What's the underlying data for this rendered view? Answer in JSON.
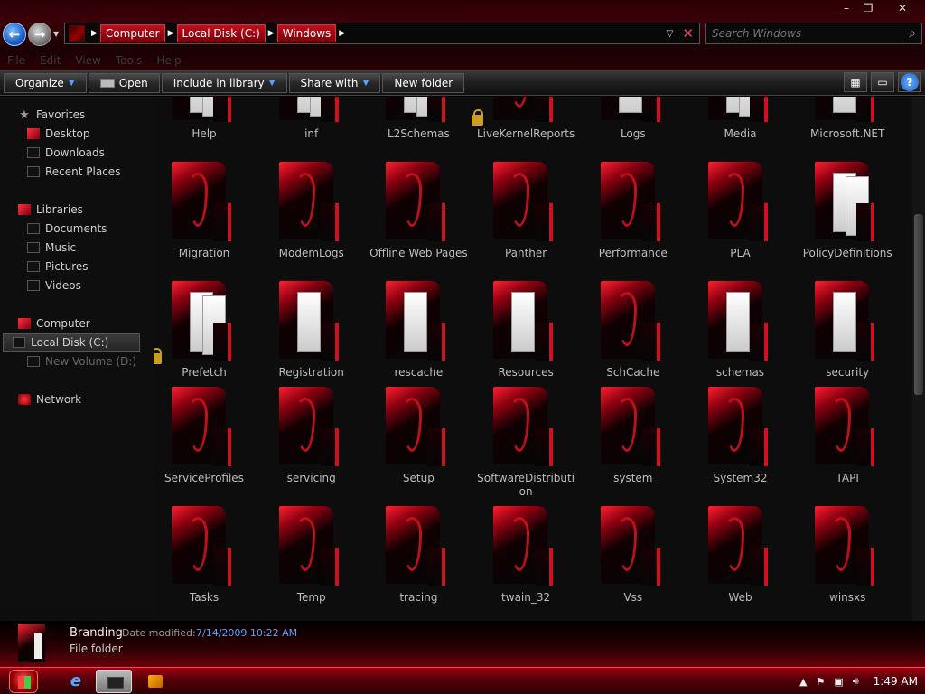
{
  "breadcrumb": [
    "Computer",
    "Local Disk (C:)",
    "Windows"
  ],
  "search": {
    "placeholder": "Search Windows"
  },
  "menu": [
    "File",
    "Edit",
    "View",
    "Tools",
    "Help"
  ],
  "toolbar": {
    "organize": "Organize",
    "open": "Open",
    "include": "Include in library",
    "share": "Share with",
    "newfolder": "New folder"
  },
  "nav": {
    "favorites": "Favorites",
    "desktop": "Desktop",
    "downloads": "Downloads",
    "recent": "Recent Places",
    "libraries": "Libraries",
    "documents": "Documents",
    "music": "Music",
    "pictures": "Pictures",
    "videos": "Videos",
    "computer": "Computer",
    "localdisk": "Local Disk (C:)",
    "newvolume": "New Volume (D:)",
    "network": "Network"
  },
  "folders": [
    {
      "name": "Help",
      "style": "paper2",
      "locked": false
    },
    {
      "name": "inf",
      "style": "paper2",
      "locked": false
    },
    {
      "name": "L2Schemas",
      "style": "paper2",
      "locked": false
    },
    {
      "name": "LiveKernelReports",
      "style": "dragon",
      "locked": true
    },
    {
      "name": "Logs",
      "style": "paper1",
      "locked": false
    },
    {
      "name": "Media",
      "style": "paper2",
      "locked": false
    },
    {
      "name": "Microsoft.NET",
      "style": "paper1",
      "locked": false
    },
    {
      "name": "Migration",
      "style": "dragon",
      "locked": false
    },
    {
      "name": "ModemLogs",
      "style": "dragon",
      "locked": false
    },
    {
      "name": "Offline Web Pages",
      "style": "dragon",
      "locked": false
    },
    {
      "name": "Panther",
      "style": "dragon",
      "locked": false
    },
    {
      "name": "Performance",
      "style": "dragon",
      "locked": false
    },
    {
      "name": "PLA",
      "style": "dragon",
      "locked": false
    },
    {
      "name": "PolicyDefinitions",
      "style": "paper2",
      "locked": false
    },
    {
      "name": "Prefetch",
      "style": "paper2",
      "locked": true
    },
    {
      "name": "Registration",
      "style": "paper1",
      "locked": false
    },
    {
      "name": "rescache",
      "style": "paper1",
      "locked": false
    },
    {
      "name": "Resources",
      "style": "paper1",
      "locked": false
    },
    {
      "name": "SchCache",
      "style": "dragon",
      "locked": false
    },
    {
      "name": "schemas",
      "style": "paper1",
      "locked": false
    },
    {
      "name": "security",
      "style": "paper1",
      "locked": false
    },
    {
      "name": "ServiceProfiles",
      "style": "dragon",
      "locked": false
    },
    {
      "name": "servicing",
      "style": "dragon",
      "locked": false
    },
    {
      "name": "Setup",
      "style": "dragon",
      "locked": false
    },
    {
      "name": "SoftwareDistribution",
      "style": "dragon",
      "locked": false
    },
    {
      "name": "system",
      "style": "dragon",
      "locked": false
    },
    {
      "name": "System32",
      "style": "dragon",
      "locked": false
    },
    {
      "name": "TAPI",
      "style": "dragon",
      "locked": false
    },
    {
      "name": "Tasks",
      "style": "dragon",
      "locked": false
    },
    {
      "name": "Temp",
      "style": "dragon",
      "locked": false
    },
    {
      "name": "tracing",
      "style": "dragon",
      "locked": false
    },
    {
      "name": "twain_32",
      "style": "dragon",
      "locked": false
    },
    {
      "name": "Vss",
      "style": "dragon",
      "locked": false
    },
    {
      "name": "Web",
      "style": "dragon",
      "locked": false
    },
    {
      "name": "winsxs",
      "style": "dragon",
      "locked": false
    }
  ],
  "details": {
    "name": "Branding",
    "modified_label": "Date modified:",
    "modified_value": "7/14/2009 10:22 AM",
    "type": "File folder"
  },
  "taskbar": {
    "clock": "1:49 AM"
  },
  "colors": {
    "accent": "#c0101e",
    "link": "#5aa0ff"
  }
}
